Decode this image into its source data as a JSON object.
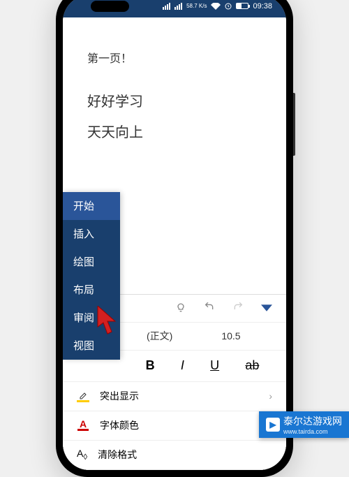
{
  "status": {
    "speed": "58.7\nK/s",
    "time": "09:38"
  },
  "document": {
    "line1": "第一页！",
    "line2": "好好学习",
    "line3": "天天向上"
  },
  "tabs": {
    "items": [
      {
        "label": "开始",
        "active": true
      },
      {
        "label": "插入"
      },
      {
        "label": "绘图"
      },
      {
        "label": "布局"
      },
      {
        "label": "审阅"
      },
      {
        "label": "视图"
      }
    ]
  },
  "font": {
    "name_suffix": "(正文)",
    "size": "10.5"
  },
  "styles": {
    "bold": "B",
    "italic": "I",
    "underline": "U",
    "strike": "ab"
  },
  "options": {
    "highlight": "突出显示",
    "fontcolor": "字体颜色",
    "clearformat": "清除格式"
  },
  "watermark": {
    "text": "泰尔达游戏网",
    "url": "www.tairda.com"
  }
}
